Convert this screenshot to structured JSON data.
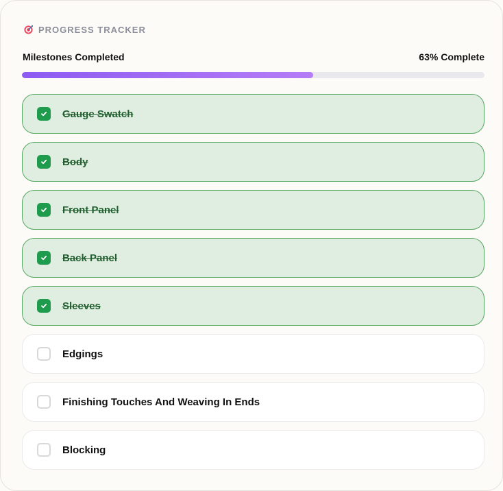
{
  "header": {
    "icon": "target-icon",
    "title": "PROGRESS TRACKER"
  },
  "progress": {
    "label": "Milestones Completed",
    "percent_text": "63% Complete",
    "percent": 63,
    "fill_colors": [
      "#8d5bf2",
      "#b67cf7"
    ],
    "track_color": "#e9e8ed"
  },
  "milestones": [
    {
      "label": "Gauge Swatch",
      "completed": true
    },
    {
      "label": "Body",
      "completed": true
    },
    {
      "label": "Front Panel",
      "completed": true
    },
    {
      "label": "Back Panel",
      "completed": true
    },
    {
      "label": "Sleeves",
      "completed": true
    },
    {
      "label": "Edgings",
      "completed": false
    },
    {
      "label": "Finishing Touches And Weaving In Ends",
      "completed": false
    },
    {
      "label": "Blocking",
      "completed": false
    }
  ],
  "colors": {
    "completed_background": "#dfeee1",
    "completed_border": "#56a761",
    "completed_text": "#245f31",
    "checkbox_completed": "#1f9b4d",
    "incomplete_border": "#d8d8d8"
  }
}
